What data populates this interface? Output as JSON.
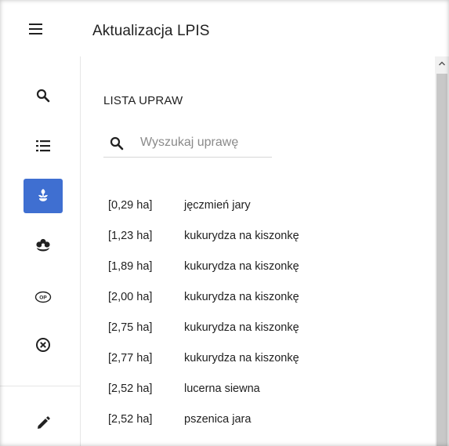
{
  "header": {
    "title": "Aktualizacja LPIS"
  },
  "sidebar": {
    "items": [
      {
        "icon": "search-icon"
      },
      {
        "icon": "list-icon"
      },
      {
        "icon": "sprout-icon",
        "active": true
      },
      {
        "icon": "flower-icon"
      },
      {
        "icon": "op-badge-icon",
        "label": "OP"
      },
      {
        "icon": "cancel-circle-icon"
      },
      {
        "icon": "pencil-icon"
      }
    ]
  },
  "main": {
    "section_title": "LISTA UPRAW",
    "search": {
      "placeholder": "Wyszukaj uprawę",
      "value": ""
    },
    "crops": [
      {
        "area": "[0,29 ha]",
        "name": "jęczmień jary"
      },
      {
        "area": "[1,23 ha]",
        "name": "kukurydza na kiszonkę"
      },
      {
        "area": "[1,89 ha]",
        "name": "kukurydza na kiszonkę"
      },
      {
        "area": "[2,00 ha]",
        "name": "kukurydza na kiszonkę"
      },
      {
        "area": "[2,75 ha]",
        "name": "kukurydza na kiszonkę"
      },
      {
        "area": "[2,77 ha]",
        "name": "kukurydza na kiszonkę"
      },
      {
        "area": "[2,52 ha]",
        "name": "lucerna siewna"
      },
      {
        "area": "[2,52 ha]",
        "name": "pszenica jara"
      }
    ]
  },
  "colors": {
    "accent": "#3f6fd1",
    "text": "#212121",
    "placeholder": "#8a8a8a",
    "divider": "#e6e6e6"
  }
}
